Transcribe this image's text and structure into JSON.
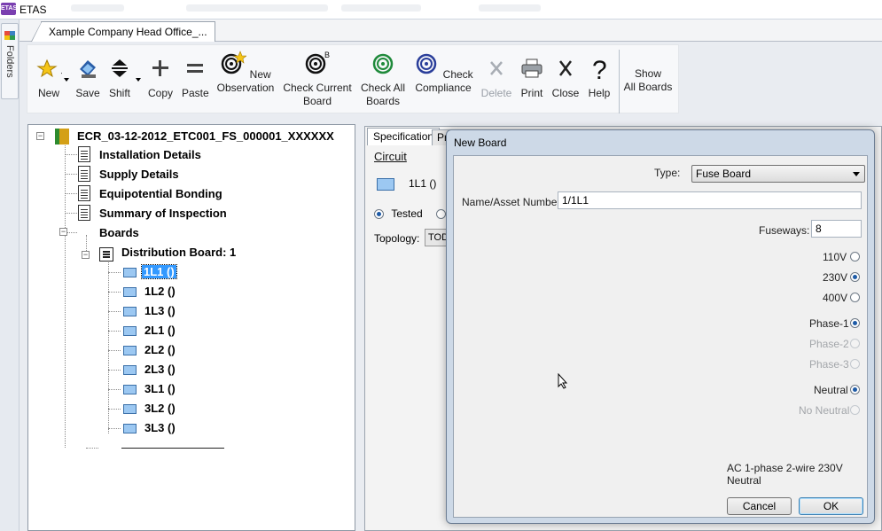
{
  "app": {
    "logo": "ETAS",
    "title": "ETAS"
  },
  "sidebar": {
    "folders_label": "Folders"
  },
  "document_tab": {
    "label": "Xample Company Head Office_..."
  },
  "ribbon": {
    "buttons": [
      {
        "id": "new",
        "label": "New",
        "icon": "star-icon",
        "dropdown": true
      },
      {
        "id": "save",
        "label": "Save",
        "icon": "save-icon",
        "dropdown": false
      },
      {
        "id": "shift",
        "label": "Shift",
        "icon": "shift-icon",
        "dropdown": true
      },
      {
        "id": "copy",
        "label": "Copy",
        "icon": "plus-icon",
        "dropdown": false
      },
      {
        "id": "paste",
        "label": "Paste",
        "icon": "equals-icon",
        "dropdown": false
      },
      {
        "id": "new_observation",
        "label": "New\nObservation",
        "icon": "spiral-star-icon",
        "dropdown": false
      },
      {
        "id": "check_current_board",
        "label": "Check Current\nBoard",
        "icon": "spiral-b-icon",
        "dropdown": false
      },
      {
        "id": "check_all_boards",
        "label": "Check All\nBoards",
        "icon": "spiral-green-icon",
        "dropdown": false
      },
      {
        "id": "check_compliance",
        "label": "Check\nCompliance",
        "icon": "spiral-blue-icon",
        "dropdown": false
      },
      {
        "id": "delete",
        "label": "Delete",
        "icon": "x-gray-icon",
        "dropdown": false,
        "disabled": true
      },
      {
        "id": "print",
        "label": "Print",
        "icon": "printer-icon",
        "dropdown": false
      },
      {
        "id": "close",
        "label": "Close",
        "icon": "x-icon",
        "dropdown": false
      },
      {
        "id": "help",
        "label": "Help",
        "icon": "question-icon",
        "dropdown": false
      }
    ],
    "show_all_boards": "Show\nAll Boards"
  },
  "tree": {
    "root": "ECR_03-12-2012_ETC001_FS_000001_XXXXXX",
    "sections": [
      "Installation Details",
      "Supply Details",
      "Equipotential Bonding",
      "Summary of Inspection"
    ],
    "boards_label": "Boards",
    "board": "Distribution Board: 1",
    "circuits": [
      "1L1 ()",
      "1L2 ()",
      "1L3 ()",
      "2L1 ()",
      "2L2 ()",
      "2L3 ()",
      "3L1 ()",
      "3L2 ()",
      "3L3 ()"
    ],
    "selected_circuit": "1L1 ()"
  },
  "right_panel": {
    "tabs": [
      "Specification",
      "Pr"
    ],
    "circuit_link": "Circuit",
    "circuit_name": "1L1 ()",
    "tested_label": "Tested",
    "topology_label": "Topology:",
    "topology_value": "TOD"
  },
  "dialog": {
    "title": "New Board",
    "type_label": "Type:",
    "type_value": "Fuse Board",
    "name_label": "Name/Asset Number:",
    "name_value": "1/1L1",
    "fuseways_label": "Fuseways:",
    "fuseways_value": "8",
    "voltages": [
      {
        "label": "110V",
        "checked": false,
        "disabled": false
      },
      {
        "label": "230V",
        "checked": true,
        "disabled": false
      },
      {
        "label": "400V",
        "checked": false,
        "disabled": false
      }
    ],
    "phases": [
      {
        "label": "Phase-1",
        "checked": true,
        "disabled": false
      },
      {
        "label": "Phase-2",
        "checked": false,
        "disabled": true
      },
      {
        "label": "Phase-3",
        "checked": false,
        "disabled": true
      }
    ],
    "neutrals": [
      {
        "label": "Neutral",
        "checked": true,
        "disabled": false
      },
      {
        "label": "No Neutral",
        "checked": false,
        "disabled": true
      }
    ],
    "summary": "AC 1-phase 2-wire 230V Neutral",
    "cancel": "Cancel",
    "ok": "OK"
  }
}
